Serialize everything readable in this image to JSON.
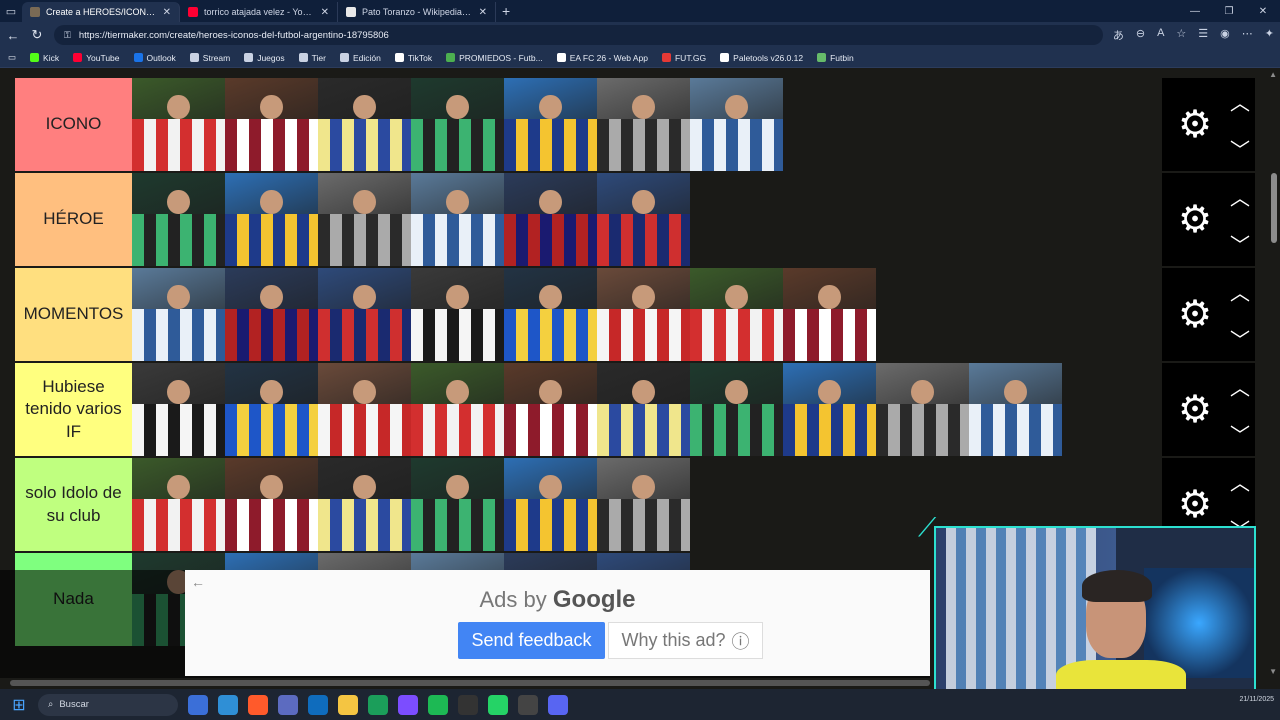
{
  "browser": {
    "tabs": [
      {
        "label": "Create a HEROES/ICONOS del FU",
        "active": true,
        "favicon_color": "#7a6a55"
      },
      {
        "label": "torrico atajada velez - YouTube",
        "active": false,
        "favicon_color": "#ff0033"
      },
      {
        "label": "Pato Toranzo - Wikipedia, la encic",
        "active": false,
        "favicon_color": "#e8e8e8"
      }
    ],
    "new_tab": "+",
    "url": "https://tiermaker.com/create/heroes-iconos-del-futbol-argentino-18795806",
    "bookmarks": [
      {
        "label": "Kick",
        "color": "#53fc18"
      },
      {
        "label": "YouTube",
        "color": "#ff0033"
      },
      {
        "label": "Outlook",
        "color": "#1a73e8"
      },
      {
        "label": "Stream",
        "color": "#c9d2e3"
      },
      {
        "label": "Juegos",
        "color": "#c9d2e3"
      },
      {
        "label": "Tier",
        "color": "#c9d2e3"
      },
      {
        "label": "Edición",
        "color": "#c9d2e3"
      },
      {
        "label": "TikTok",
        "color": "#ffffff"
      },
      {
        "label": "PROMIEDOS - Futb...",
        "color": "#4caf50"
      },
      {
        "label": "EA FC 26 - Web App",
        "color": "#ffffff"
      },
      {
        "label": "FUT.GG",
        "color": "#e53935"
      },
      {
        "label": "Paletools v26.0.12",
        "color": "#ffffff"
      },
      {
        "label": "Futbin",
        "color": "#66bb6a"
      }
    ]
  },
  "tiers": [
    {
      "label": "ICONO",
      "color": "#ff7f7f",
      "items": 7
    },
    {
      "label": "HÉROE",
      "color": "#ffbf7f",
      "items": 6
    },
    {
      "label": "MOMENTOS",
      "color": "#ffdf7f",
      "items": 8
    },
    {
      "label": "Hubiese tenido varios IF",
      "color": "#ffff7f",
      "items": 10
    },
    {
      "label": "solo Idolo de su club",
      "color": "#bfff7f",
      "items": 6
    },
    {
      "label": "Nada",
      "color": "#7fff7f",
      "items": 6
    }
  ],
  "tier_controls": {
    "settings_icon": "gear-icon",
    "up_icon": "chevron-up-icon",
    "down_icon": "chevron-down-icon"
  },
  "ad": {
    "ads_by": "Ads by",
    "brand": "Google",
    "send_feedback": "Send feedback",
    "why_this_ad": "Why this ad?"
  },
  "taskbar": {
    "search_placeholder": "Buscar",
    "date": "21/11/2025"
  }
}
